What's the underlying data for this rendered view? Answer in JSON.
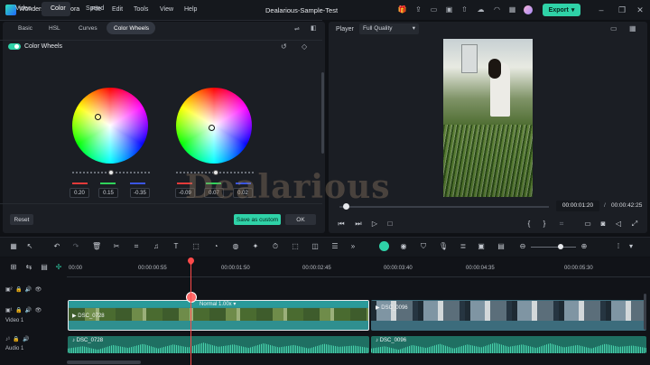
{
  "app": {
    "name": "Wondershare Filmora",
    "menu": [
      "File",
      "Edit",
      "Tools",
      "View",
      "Help"
    ],
    "document_title": "Dealarious-Sample-Test",
    "export_label": "Export"
  },
  "left_panel": {
    "tabs": [
      "Video",
      "Color",
      "Speed"
    ],
    "active_tab": "Color",
    "subtabs": [
      "Basic",
      "HSL",
      "Curves",
      "Color Wheels"
    ],
    "active_subtab": "Color Wheels",
    "section_title": "Color Wheels",
    "section_enabled": true,
    "wheels": [
      {
        "values": [
          "0.20",
          "0.15",
          "-0.35"
        ]
      },
      {
        "values": [
          "-0.09",
          "0.07",
          "0.02"
        ]
      }
    ],
    "reset_label": "Reset",
    "save_custom_label": "Save as custom",
    "ok_label": "OK"
  },
  "player": {
    "label": "Player",
    "quality": "Full Quality",
    "current_time": "00:00:01:20",
    "separator": "/",
    "total_time": "00:00:42:25"
  },
  "timeline": {
    "ruler_labels": [
      "00:00",
      "00:00:00:55",
      "00:00:01:50",
      "00:00:02:45",
      "00:00:03:40",
      "00:00:04:35",
      "00:00:05:30"
    ],
    "video_track_label": "Video 1",
    "audio_track_label": "Audio 1",
    "clip1_label": "DSC_0728",
    "clip1_speed": "Normal 1.00x",
    "clip2_label": "DSC_0096",
    "audio1_label": "DSC_0728",
    "audio2_label": "DSC_0096"
  },
  "watermark": "Dealarious",
  "colors": {
    "accent": "#2fd2a8",
    "playhead": "#ff4a4a",
    "panel": "#1b1e24",
    "background": "#0f1115"
  }
}
